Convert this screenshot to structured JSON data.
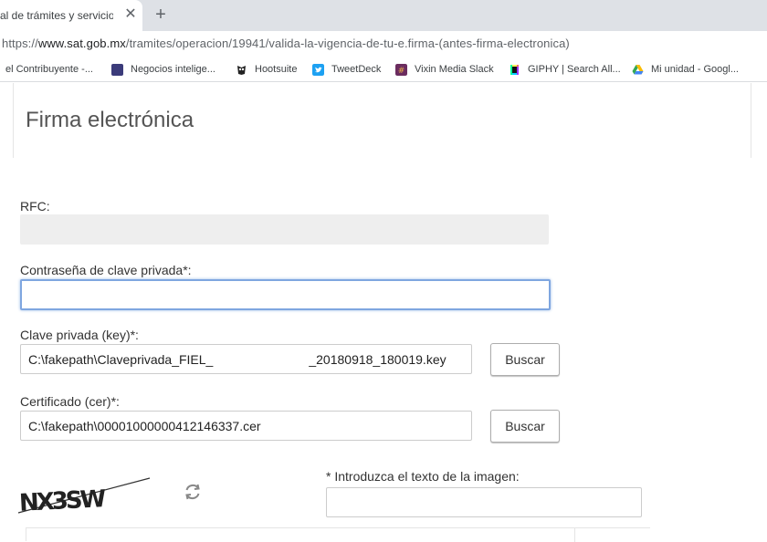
{
  "browser": {
    "tab_title": "al de trámites y servicios - S",
    "tab_close": "✕",
    "new_tab": "+",
    "url": {
      "scheme": "https://",
      "host": "www.sat.gob.mx",
      "path": "/tramites/operacion/19941/valida-la-vigencia-de-tu-e.firma-(antes-firma-electronica)"
    },
    "bookmarks": [
      {
        "label": "el Contribuyente -...",
        "icon": "document-icon",
        "color": "#8a8a8a"
      },
      {
        "label": "Negocios intelige...",
        "icon": "bookmark-site-icon",
        "color": "#3b3b7a"
      },
      {
        "label": "Hootsuite",
        "icon": "owl-icon",
        "color": "#222222"
      },
      {
        "label": "TweetDeck",
        "icon": "twitter-icon",
        "color": "#1da1f2"
      },
      {
        "label": "Vixin Media Slack",
        "icon": "slack-icon",
        "color": "#6b2c5f"
      },
      {
        "label": "GIPHY | Search All...",
        "icon": "giphy-icon",
        "color": "#e6007e"
      },
      {
        "label": "Mi unidad - Googl...",
        "icon": "google-drive-icon",
        "color": "#34a853"
      }
    ]
  },
  "form": {
    "title": "Firma electrónica",
    "rfc": {
      "label": "RFC:",
      "value": ""
    },
    "password": {
      "label": "Contraseña de clave privada*:",
      "value": ""
    },
    "key": {
      "label": "Clave privada (key)*:",
      "value": "C:\\fakepath\\Claveprivada_FIEL_                           _20180918_180019.key",
      "button": "Buscar"
    },
    "cer": {
      "label": "Certificado (cer)*:",
      "value": "C:\\fakepath\\00001000000412146337.cer",
      "button": "Buscar"
    },
    "captcha": {
      "text": "NX3SW",
      "prompt": "* Introduzca el texto de la imagen:",
      "value": ""
    }
  }
}
